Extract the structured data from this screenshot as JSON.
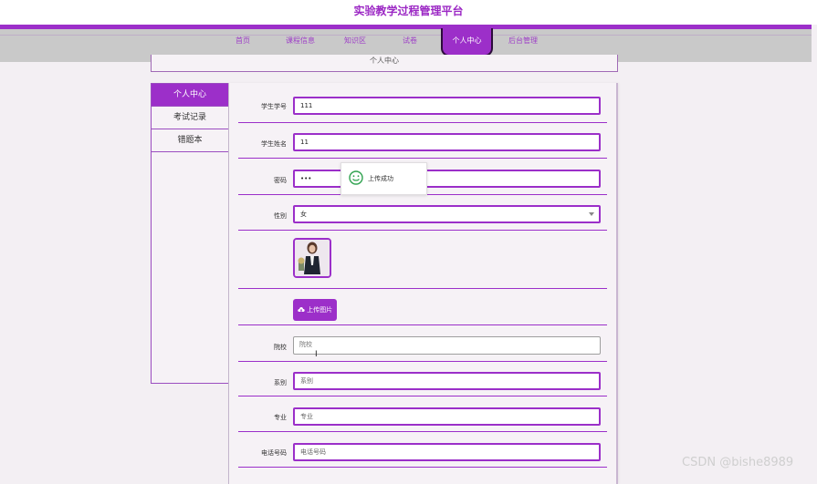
{
  "app": {
    "title": "实验教学过程管理平台",
    "nav": [
      {
        "label": "首页"
      },
      {
        "label": "课程信息"
      },
      {
        "label": "知识区"
      },
      {
        "label": "试卷"
      },
      {
        "label": "个人中心"
      },
      {
        "label": "后台管理"
      }
    ],
    "active_nav": "个人中心",
    "banner": "个人中心"
  },
  "sidebar": {
    "items": [
      {
        "label": "个人中心"
      },
      {
        "label": "考试记录"
      },
      {
        "label": "错题本"
      }
    ],
    "active": "个人中心"
  },
  "form": {
    "student_id": {
      "label": "学生学号",
      "value": "111"
    },
    "student_name": {
      "label": "学生姓名",
      "value": "11"
    },
    "password": {
      "label": "密码",
      "value": "•••"
    },
    "gender": {
      "label": "性别",
      "value": "女"
    },
    "upload_button": "上传图片",
    "college": {
      "label": "院校",
      "placeholder": "院校"
    },
    "department": {
      "label": "系别",
      "placeholder": "系别"
    },
    "major": {
      "label": "专业",
      "placeholder": "专业"
    },
    "phone": {
      "label": "电话号码",
      "placeholder": "电话号码"
    }
  },
  "toast": {
    "text": "上传成功"
  },
  "watermark": "CSDN @bishe8989",
  "colors": {
    "accent": "#9c2fc9",
    "nav_bg": "#c9c9c9",
    "page_bg": "#f3eff3"
  },
  "icons": {
    "toast": "smile-icon",
    "upload": "cloud-upload-icon",
    "select": "chevron-down-icon"
  }
}
